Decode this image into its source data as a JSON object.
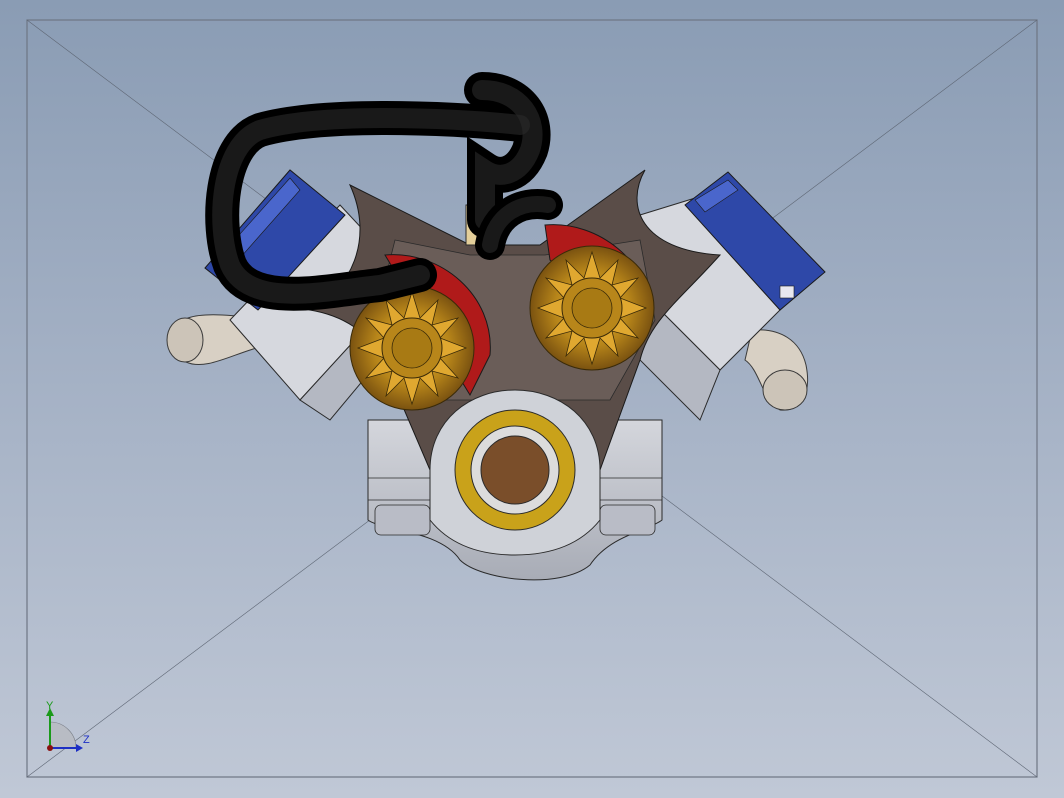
{
  "viewport": {
    "background_top": "#8a9cb4",
    "background_bottom": "#c0c8d6"
  },
  "triad": {
    "y_label": "Y",
    "z_label": "Z",
    "y_color": "#1a9a1a",
    "z_color": "#1d2fc4"
  },
  "colors": {
    "hose": "#111111",
    "cover": "#2e48a8",
    "valley": "#5a4d48",
    "gear": "#b8861a",
    "pulley_red": "#b01a1a",
    "block": "#c4c7cf",
    "pipe": "#d8d0c4",
    "bushing": "#c9a21a",
    "bore": "#7a4e2a"
  }
}
